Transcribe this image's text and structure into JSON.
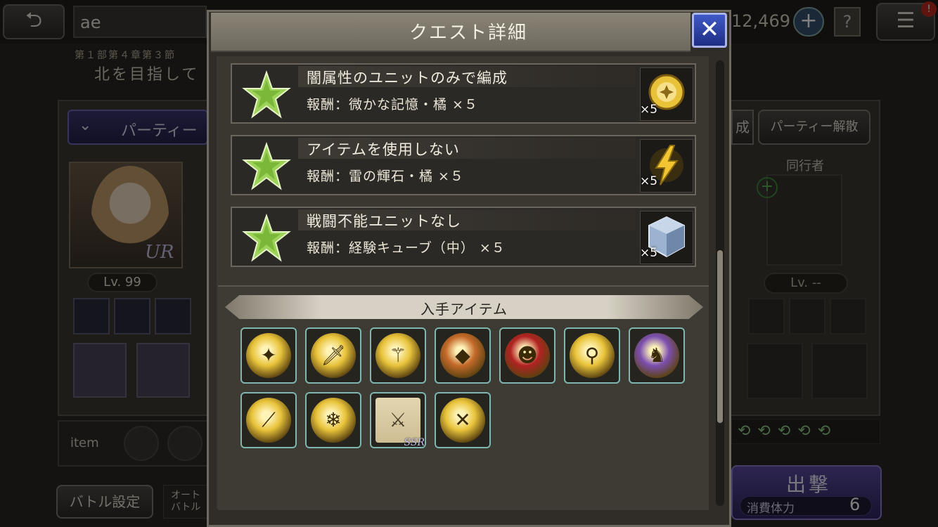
{
  "background": {
    "back_icon": "back-arrow-icon",
    "player_name": "ae",
    "gem_count": "12,469",
    "notification_badge": "!",
    "chapter": "第１部第４章第３節",
    "chapter_title": "北を目指して",
    "party_label": "パーティー",
    "formation_label": "成",
    "disband_label": "パーティー解散",
    "unit_level": "Lv. 99",
    "unit_rarity": "UR",
    "companion_label": "同行者",
    "companion_level": "Lv. --",
    "item_label": "item",
    "battle_settings_label": "バトル設定",
    "auto_label_line1": "オート",
    "auto_label_line2": "バトル",
    "sortie_label": "出撃",
    "stamina_label": "消費体力",
    "stamina_value": "6"
  },
  "modal": {
    "title": "クエスト詳細",
    "close_icon": "close-icon",
    "missions": [
      {
        "title": "闇属性のユニットのみで編成",
        "reward": "報酬：微かな記憶・橘 ×５",
        "quantity": "×5",
        "icon": "memory-orb-icon",
        "icon_color": "#e8c33a"
      },
      {
        "title": "アイテムを使用しない",
        "reward": "報酬：雷の輝石・橘 ×５",
        "quantity": "×5",
        "icon": "thunder-stone-icon",
        "icon_color": "#f2c632"
      },
      {
        "title": "戦闘不能ユニットなし",
        "reward": "報酬：経験キューブ（中） ×５",
        "quantity": "×5",
        "icon": "exp-cube-icon",
        "icon_color": "#9bb2d0"
      }
    ],
    "items_title": "入手アイテム",
    "items": [
      {
        "icon": "memory-orb-icon",
        "glyph": "✦",
        "color": "#e8c33a"
      },
      {
        "icon": "sword-crystal-icon",
        "glyph": "🗡",
        "color": "#e8c33a"
      },
      {
        "icon": "staff-crystal-icon",
        "glyph": "⚚",
        "color": "#e8c33a"
      },
      {
        "icon": "amber-stone-icon",
        "glyph": "◆",
        "color": "#c46a2a"
      },
      {
        "icon": "red-mask-icon",
        "glyph": "☻",
        "color": "#b22222"
      },
      {
        "icon": "scepter-orb-icon",
        "glyph": "⚲",
        "color": "#e8c33a"
      },
      {
        "icon": "dragon-icon",
        "glyph": "♞",
        "color": "#7b4fb0"
      },
      {
        "icon": "spear-orb-icon",
        "glyph": "⟋",
        "color": "#e8c33a"
      },
      {
        "icon": "snowflake-crystal-icon",
        "glyph": "❄",
        "color": "#e8c33a"
      },
      {
        "icon": "weapon-scroll-icon",
        "glyph": "⚔",
        "color": "#cdbd93",
        "badge": "SSR"
      },
      {
        "icon": "crossed-guns-orb-icon",
        "glyph": "✕",
        "color": "#e8c33a"
      }
    ]
  },
  "colors": {
    "accent_gold": "#e8c33a",
    "close_blue": "#2f44b0",
    "star_green": "#9ed35a"
  }
}
